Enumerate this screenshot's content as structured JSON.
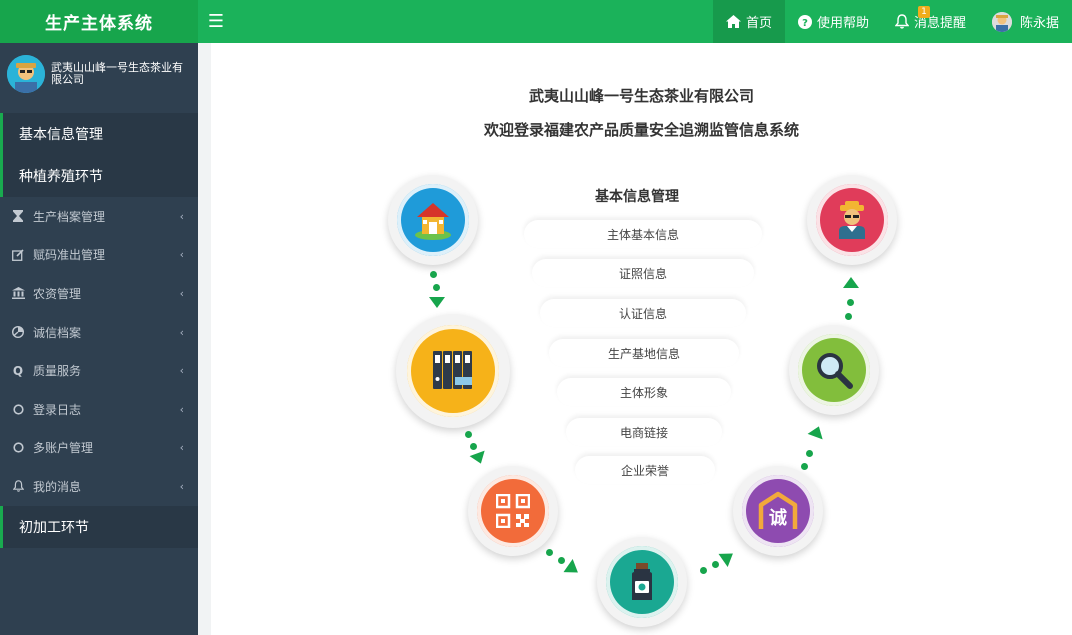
{
  "app": {
    "title": "生产主体系统"
  },
  "topbar": {
    "menu_icon": "hamburger-icon",
    "home": "首页",
    "help": "使用帮助",
    "messages": "消息提醒",
    "message_count": "1",
    "user": "陈永据"
  },
  "sidebar": {
    "company_name": "武夷山山峰一号生态茶业有限公司",
    "sections": {
      "basic": "基本信息管理",
      "planting": "种植养殖环节",
      "processing": "初加工环节"
    },
    "items": [
      {
        "label": "生产档案管理",
        "icon": "hourglass-icon"
      },
      {
        "label": "赋码准出管理",
        "icon": "edit-icon"
      },
      {
        "label": "农资管理",
        "icon": "bank-icon"
      },
      {
        "label": "诚信档案",
        "icon": "pie-chart-icon"
      },
      {
        "label": "质量服务",
        "icon": "q-icon"
      },
      {
        "label": "登录日志",
        "icon": "circle-icon"
      },
      {
        "label": "多账户管理",
        "icon": "circle-icon"
      },
      {
        "label": "我的消息",
        "icon": "bell-icon"
      }
    ]
  },
  "main": {
    "company": "武夷山山峰一号生态茶业有限公司",
    "welcome": "欢迎登录福建农产品质量安全追溯监管信息系统",
    "menu_title": "基本信息管理",
    "menu_items": [
      "主体基本信息",
      "证照信息",
      "认证信息",
      "生产基地信息",
      "主体形象",
      "电商链接",
      "企业荣誉"
    ],
    "integrity_char": "诚",
    "colors": {
      "green": "#17a54c",
      "house": "#1f9bd9",
      "archive": "#f6b219",
      "qrcode": "#f26b3a",
      "bottle": "#1aa892",
      "integrity": "#8e4bb0",
      "search": "#82be3c",
      "farmer": "#e03c5a"
    }
  }
}
